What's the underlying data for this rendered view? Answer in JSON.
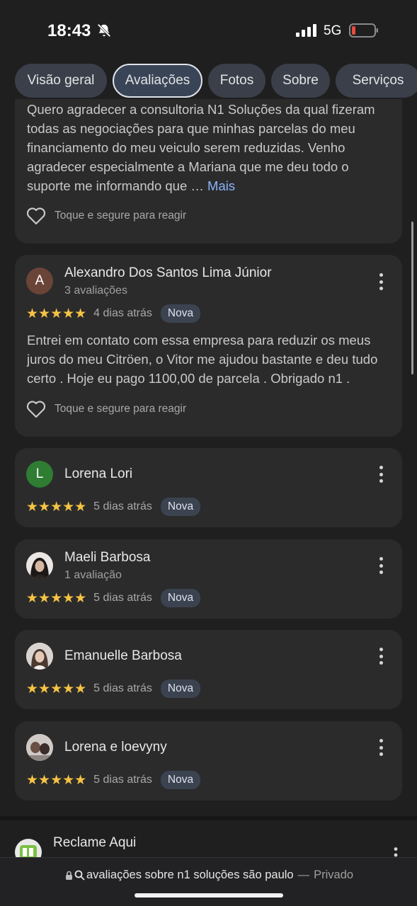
{
  "status": {
    "time": "18:43",
    "network": "5G",
    "battery_color": "#e84a3f"
  },
  "tabs": [
    {
      "label": "Visão geral",
      "active": false
    },
    {
      "label": "Avaliações",
      "active": true
    },
    {
      "label": "Fotos",
      "active": false
    },
    {
      "label": "Sobre",
      "active": false
    },
    {
      "label": "Serviços",
      "active": false
    }
  ],
  "react_label": "Toque e segure para reagir",
  "partial_review": {
    "text": "Quero agradecer a consultoria N1 Soluções da qual fizeram todas as negociações para que minhas parcelas do meu financiamento do meu veiculo serem reduzidas. Venho agradecer especialmente a Mariana que me deu todo o suporte me informando que …",
    "more": "Mais"
  },
  "reviews": [
    {
      "initial": "A",
      "avatar_color": "#6b4438",
      "name": "Alexandro Dos Santos Lima Júnior",
      "count": "3 avaliações",
      "stars": "★★★★★",
      "date": "4 dias atrás",
      "badge": "Nova",
      "text": "Entrei em contato com essa empresa para reduzir os meus juros do meu Citröen, o Vitor me ajudou bastante e deu tudo certo . Hoje eu pago 1100,00 de parcela . Obrigado n1 ."
    },
    {
      "initial": "L",
      "avatar_color": "#2e7d32",
      "name": "Lorena Lori",
      "stars": "★★★★★",
      "date": "5 dias atrás",
      "badge": "Nova"
    },
    {
      "initial": "",
      "name": "Maeli Barbosa",
      "count": "1 avaliação",
      "stars": "★★★★★",
      "date": "5 dias atrás",
      "badge": "Nova"
    },
    {
      "initial": "",
      "name": "Emanuelle Barbosa",
      "stars": "★★★★★",
      "date": "5 dias atrás",
      "badge": "Nova"
    },
    {
      "initial": "",
      "name": "Lorena e loevyny",
      "stars": "★★★★★",
      "date": "5 dias atrás",
      "badge": "Nova"
    }
  ],
  "next_place": {
    "name": "Reclame Aqui"
  },
  "url_bar": {
    "query": "avaliações sobre n1 soluções são paulo",
    "separator": "—",
    "mode": "Privado"
  }
}
